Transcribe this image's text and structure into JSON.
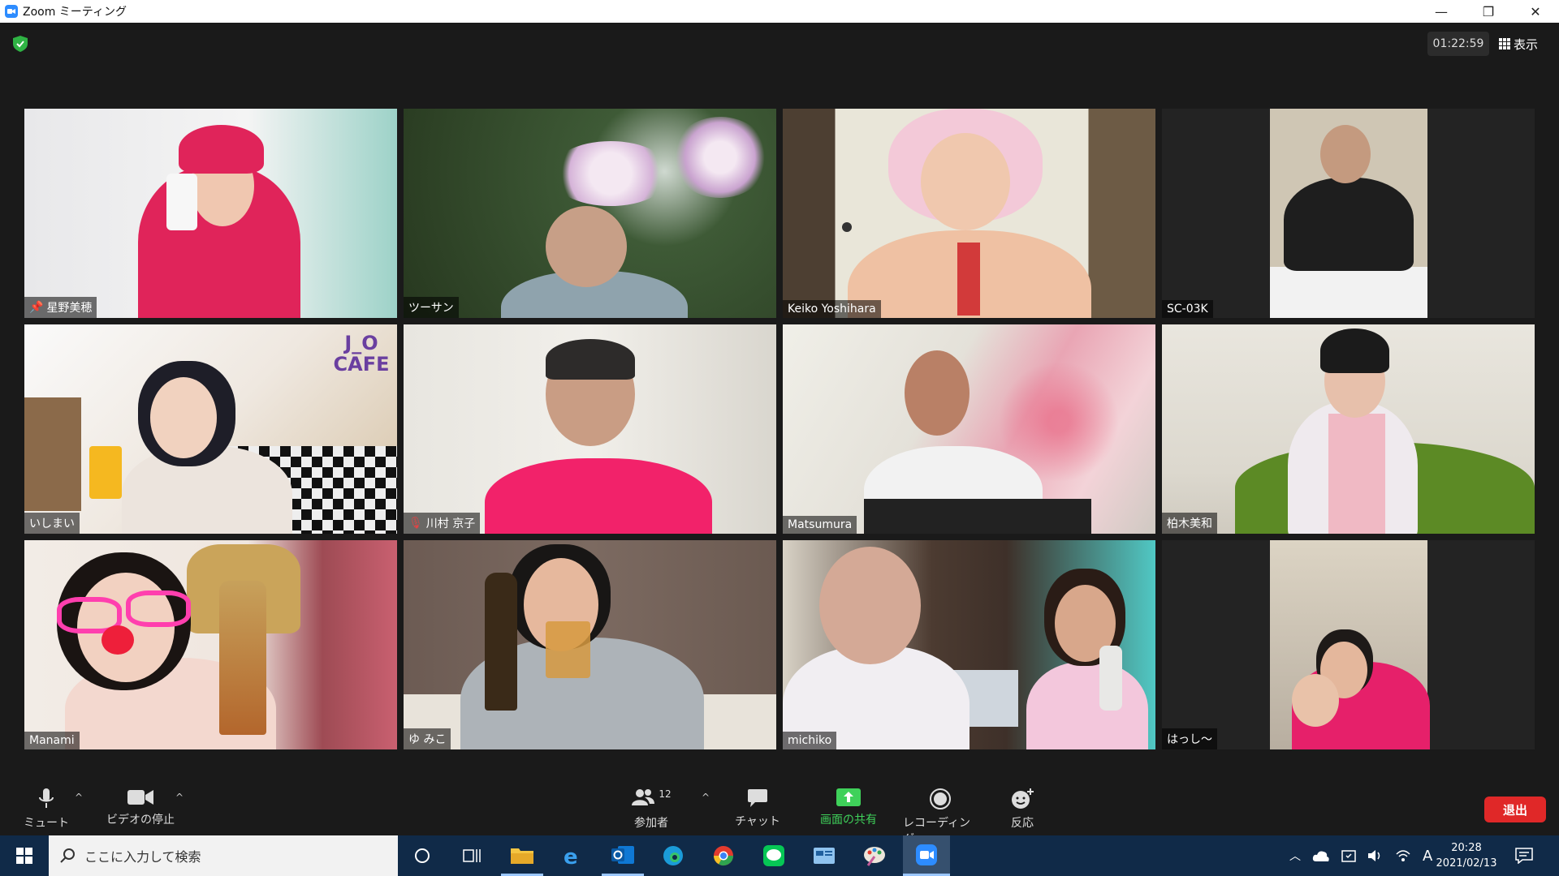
{
  "window": {
    "title": "Zoom ミーティング",
    "minimize": "—",
    "restore": "❐",
    "close": "✕"
  },
  "meeting": {
    "timer": "01:22:59",
    "view_label": "表示"
  },
  "participants": [
    {
      "name": "星野美穂",
      "has_pin": true
    },
    {
      "name": "ツーサン"
    },
    {
      "name": "Keiko Yoshihara",
      "active_speaker": true
    },
    {
      "name": "SC-03K"
    },
    {
      "name": "いしまい",
      "cafe_sign": "J_O\nCAFE"
    },
    {
      "name": "川村 京子",
      "muted": true
    },
    {
      "name": "Matsumura"
    },
    {
      "name": "柏木美和"
    },
    {
      "name": "Manami"
    },
    {
      "name": "ゆ みこ"
    },
    {
      "name": "michiko"
    },
    {
      "name": "はっし〜"
    }
  ],
  "toolbar": {
    "mute": "ミュート",
    "stop_video": "ビデオの停止",
    "participants": "参加者",
    "participant_count": "12",
    "chat": "チャット",
    "share_screen": "画面の共有",
    "recording": "レコーディング",
    "reactions": "反応",
    "leave": "退出"
  },
  "taskbar": {
    "search_placeholder": "ここに入力して検索",
    "time": "20:28",
    "date": "2021/02/13",
    "ime": "A"
  },
  "colors": {
    "share_green": "#3fd15a",
    "leave_red": "#e02828",
    "active_outline": "#e6e84a",
    "taskbar": "#102a48"
  }
}
